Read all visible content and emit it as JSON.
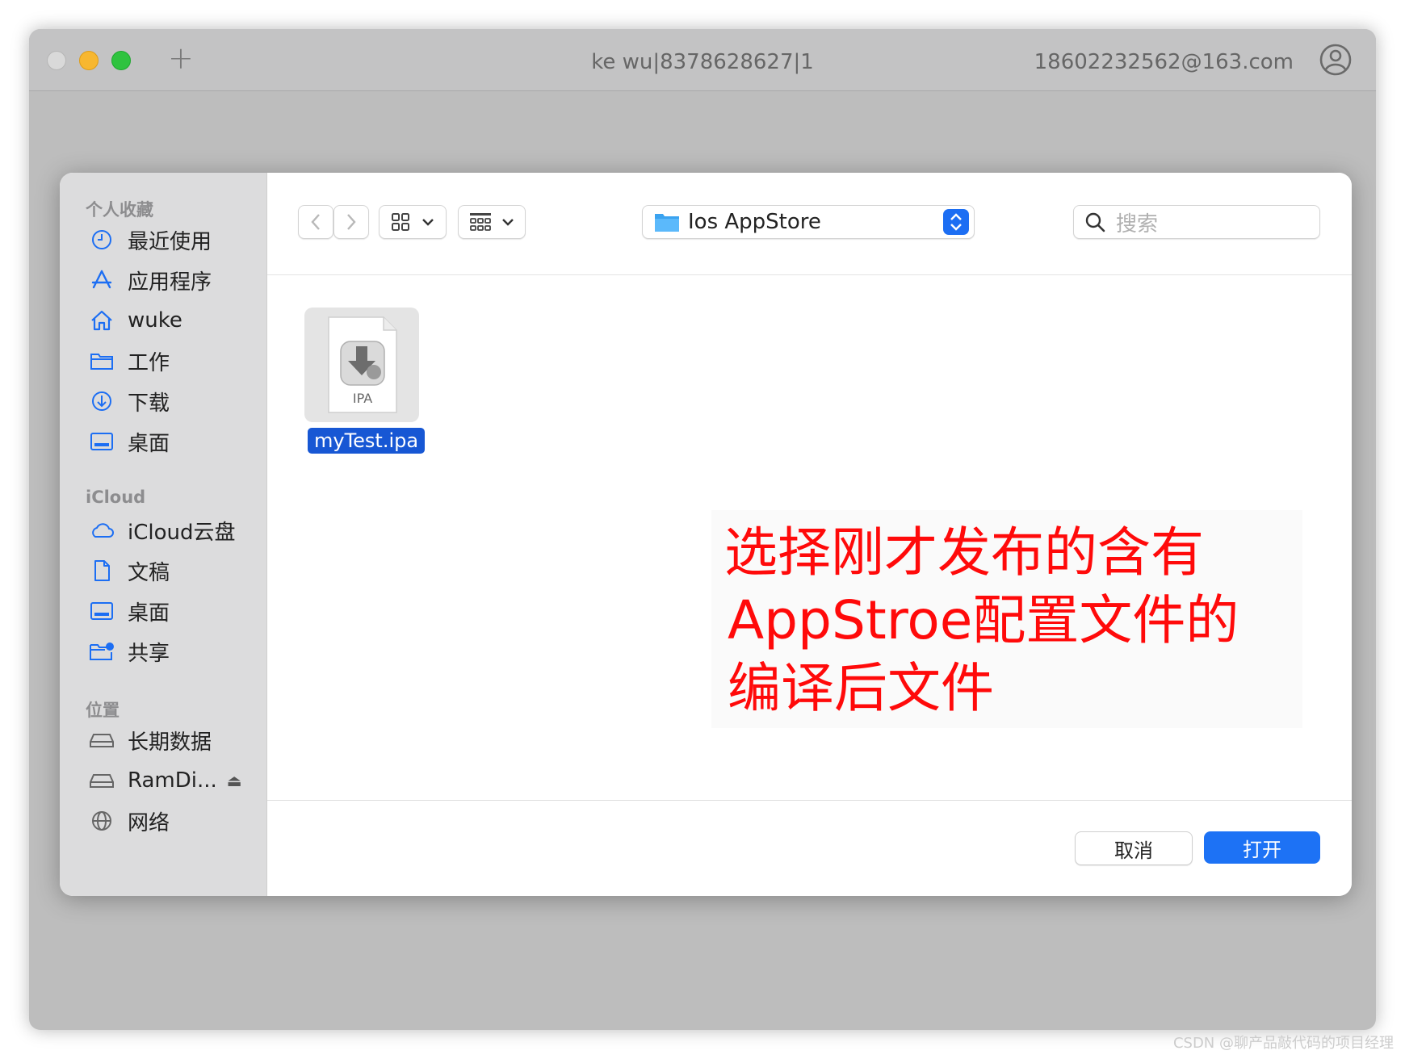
{
  "window": {
    "title": "ke wu|8378628627|1",
    "account": "18602232562@163.com"
  },
  "sidebar": {
    "sections": [
      {
        "title": "个人收藏",
        "items": [
          {
            "label": "最近使用",
            "icon": "clock-icon"
          },
          {
            "label": "应用程序",
            "icon": "appstore-icon"
          },
          {
            "label": "wuke",
            "icon": "home-icon"
          },
          {
            "label": "工作",
            "icon": "folder-icon"
          },
          {
            "label": "下载",
            "icon": "download-icon"
          },
          {
            "label": "桌面",
            "icon": "desktop-icon"
          }
        ]
      },
      {
        "title": "iCloud",
        "items": [
          {
            "label": "iCloud云盘",
            "icon": "cloud-icon"
          },
          {
            "label": "文稿",
            "icon": "document-icon"
          },
          {
            "label": "桌面",
            "icon": "desktop-icon"
          },
          {
            "label": "共享",
            "icon": "shared-folder-icon"
          }
        ]
      },
      {
        "title": "位置",
        "items": [
          {
            "label": "长期数据",
            "icon": "drive-icon"
          },
          {
            "label": "RamDi...",
            "icon": "drive-icon",
            "eject": "⏏"
          },
          {
            "label": "网络",
            "icon": "network-icon"
          }
        ]
      }
    ]
  },
  "toolbar": {
    "location": "Ios AppStore",
    "search_placeholder": "搜索"
  },
  "files": [
    {
      "name": "myTest.ipa",
      "kind": "IPA",
      "selected": true
    }
  ],
  "annotation": {
    "lines": [
      "选择刚才发布的含有",
      "AppStroe配置文件的",
      "编译后文件"
    ],
    "color": "#ff0a0a"
  },
  "buttons": {
    "cancel": "取消",
    "open": "打开"
  },
  "accent": "#1d72f5",
  "watermark": "CSDN @聊产品敲代码的项目经理"
}
